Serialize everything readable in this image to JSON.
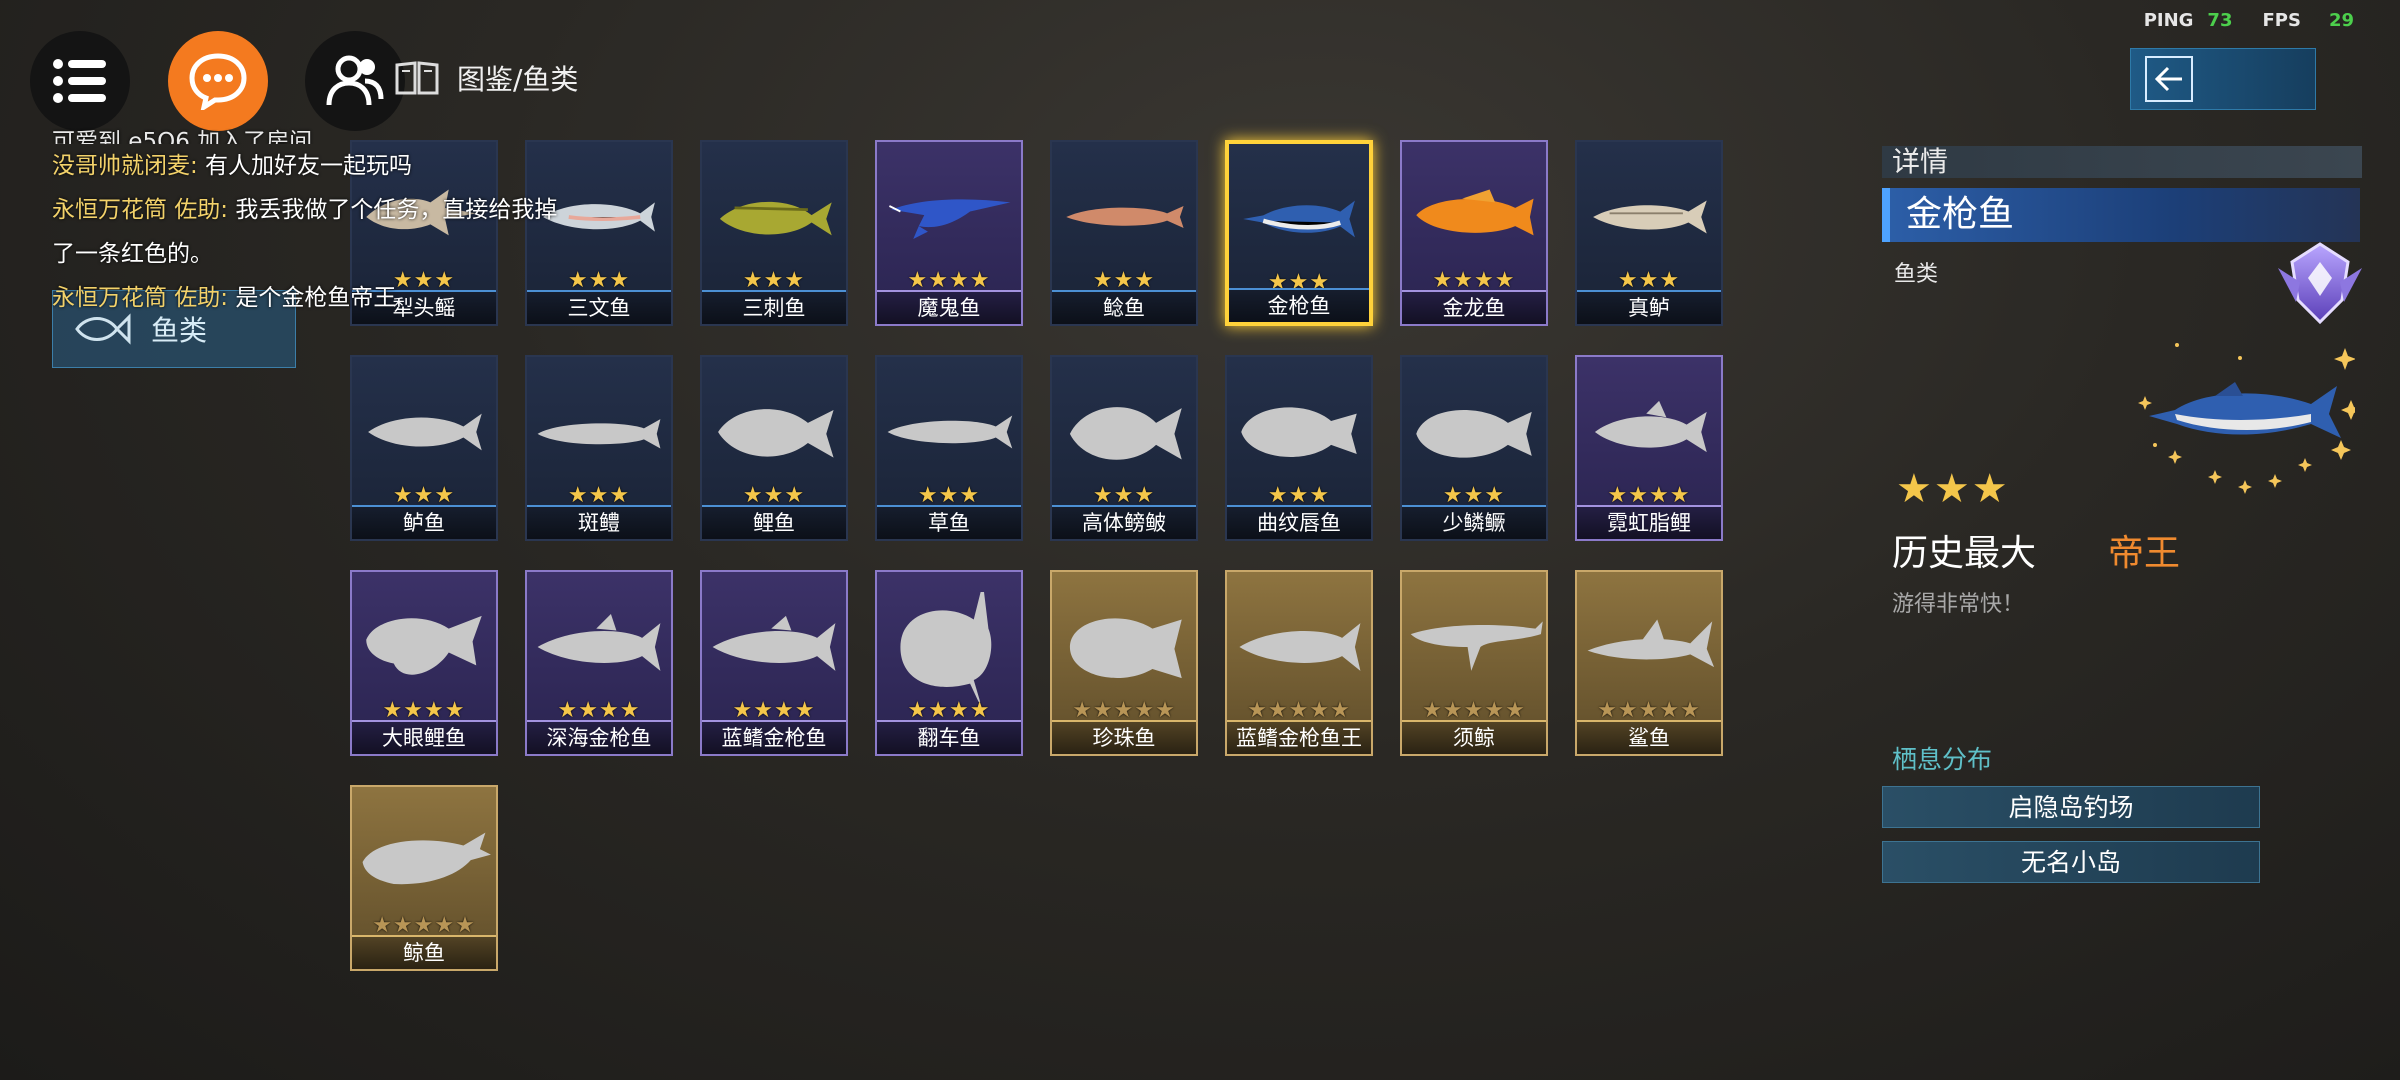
{
  "header": {
    "breadcrumb": "图鉴/鱼类",
    "ping_label": "PING",
    "ping_value": "73",
    "fps_label": "FPS",
    "fps_value": "29"
  },
  "chat": {
    "partial_top": "可爱到 e5O6 加入了房间",
    "messages": [
      {
        "name": "没哥帅就闭麦:",
        "text": " 有人加好友一起玩吗"
      },
      {
        "name": "永恒万花筒 佐助:",
        "text": " 我丢我做了个任务，直接给我掉"
      },
      {
        "name": "",
        "text": "了一条红色的。"
      },
      {
        "name": "永恒万花筒 佐助:",
        "text": " 是个金枪鱼帝王"
      }
    ],
    "category_tag": "鱼类"
  },
  "fish_cards": [
    {
      "name": "犁头鳐",
      "stars": "★★★",
      "rarity": "blue",
      "shape": "ray",
      "discovered": true
    },
    {
      "name": "三文鱼",
      "stars": "★★★",
      "rarity": "blue",
      "shape": "salmon",
      "discovered": true
    },
    {
      "name": "三刺鱼",
      "stars": "★★★",
      "rarity": "blue",
      "shape": "stickleback",
      "discovered": true
    },
    {
      "name": "魔鬼鱼",
      "stars": "★★★★",
      "rarity": "purple",
      "shape": "devilray",
      "discovered": true
    },
    {
      "name": "鲶鱼",
      "stars": "★★★",
      "rarity": "blue",
      "shape": "catfish",
      "discovered": true
    },
    {
      "name": "金枪鱼",
      "stars": "★★★",
      "rarity": "blue",
      "shape": "tuna",
      "discovered": true,
      "selected": true
    },
    {
      "name": "金龙鱼",
      "stars": "★★★★",
      "rarity": "purple",
      "shape": "arowana",
      "discovered": true
    },
    {
      "name": "真鲈",
      "stars": "★★★",
      "rarity": "blue",
      "shape": "bass",
      "discovered": true
    },
    {
      "name": "鲈鱼",
      "stars": "★★★",
      "rarity": "blue",
      "shape": "perch",
      "discovered": false
    },
    {
      "name": "斑鳢",
      "stars": "★★★",
      "rarity": "blue",
      "shape": "snakehead",
      "discovered": false
    },
    {
      "name": "鲤鱼",
      "stars": "★★★",
      "rarity": "blue",
      "shape": "carp",
      "discovered": false
    },
    {
      "name": "草鱼",
      "stars": "★★★",
      "rarity": "blue",
      "shape": "grasscarp",
      "discovered": false
    },
    {
      "name": "高体鳑鲏",
      "stars": "★★★",
      "rarity": "blue",
      "shape": "bitterling",
      "discovered": false
    },
    {
      "name": "曲纹唇鱼",
      "stars": "★★★",
      "rarity": "blue",
      "shape": "wrasse",
      "discovered": false
    },
    {
      "name": "少鳞鳜",
      "stars": "★★★",
      "rarity": "blue",
      "shape": "mandarin",
      "discovered": false
    },
    {
      "name": "霓虹脂鲤",
      "stars": "★★★★",
      "rarity": "purple",
      "shape": "tetra",
      "discovered": false
    },
    {
      "name": "大眼鲤鱼",
      "stars": "★★★★",
      "rarity": "purple",
      "shape": "bigeye",
      "discovered": false
    },
    {
      "name": "深海金枪鱼",
      "stars": "★★★★",
      "rarity": "purple",
      "shape": "tuna2",
      "discovered": false
    },
    {
      "name": "蓝鳍金枪鱼",
      "stars": "★★★★",
      "rarity": "purple",
      "shape": "tuna3",
      "discovered": false
    },
    {
      "name": "翻车鱼",
      "stars": "★★★★",
      "rarity": "purple",
      "shape": "sunfish",
      "discovered": false
    },
    {
      "name": "珍珠鱼",
      "stars": "★★★★★",
      "rarity": "gold",
      "shape": "pearl",
      "discovered": false
    },
    {
      "name": "蓝鳍金枪鱼王",
      "stars": "★★★★★",
      "rarity": "gold",
      "shape": "tunaking",
      "discovered": false
    },
    {
      "name": "须鲸",
      "stars": "★★★★★",
      "rarity": "gold",
      "shape": "baleen",
      "discovered": false
    },
    {
      "name": "鲨鱼",
      "stars": "★★★★★",
      "rarity": "gold",
      "shape": "shark",
      "discovered": false
    },
    {
      "name": "鲸鱼",
      "stars": "★★★★★",
      "rarity": "gold",
      "shape": "whale",
      "discovered": false
    }
  ],
  "detail": {
    "header": "详情",
    "name": "金枪鱼",
    "category": "鱼类",
    "stars": "★★★",
    "history_label": "历史最大",
    "history_value": "帝王",
    "description": "游得非常快！",
    "habitat_title": "栖息分布",
    "locations": [
      "启隐岛钓场",
      "无名小岛"
    ]
  },
  "colors": {
    "accent_orange": "#f47a1f",
    "gold": "#f4c64a",
    "purple_rare": "#8b7ac9",
    "history_value": "#f08a2f"
  }
}
